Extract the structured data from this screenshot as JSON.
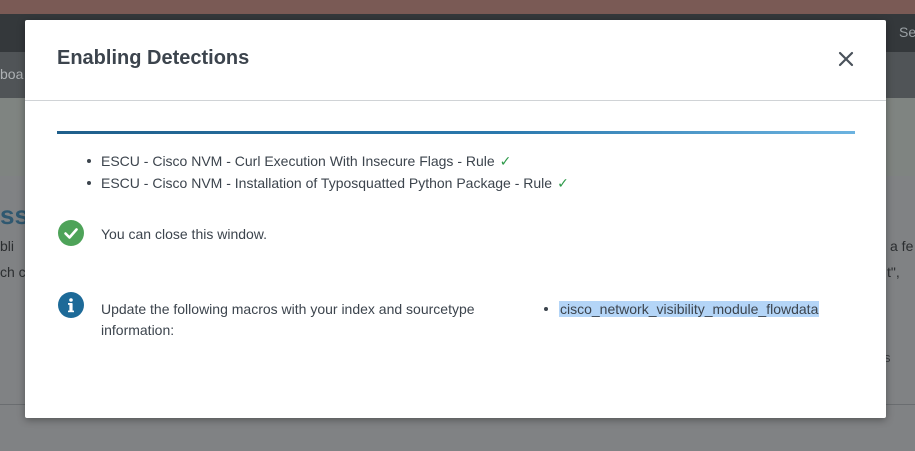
{
  "background": {
    "header_right_fragment": "Se",
    "subnav_left_fragment": "boa",
    "title_fragment": "ssi",
    "line1_fragment": "bli",
    "line2_fragment": "ch c",
    "right_fragment_1": "a fe",
    "right_fragment_2": "t\",",
    "right_fragment_3": "s"
  },
  "modal": {
    "title": "Enabling Detections",
    "close_icon": "close-icon",
    "progress": 1.0,
    "rules": [
      {
        "label": "ESCU - Cisco NVM - Curl Execution With Insecure Flags - Rule"
      },
      {
        "label": "ESCU - Cisco NVM - Installation of Typosquatted Python Package - Rule"
      }
    ],
    "check_symbol": "✓",
    "success_icon": "check-circle-icon",
    "success_message": "You can close this window.",
    "info_icon": "info-circle-icon",
    "info_message": "Update the following macros with your index and sourcetype information:",
    "macros": [
      {
        "name": "cisco_network_visibility_module_flowdata"
      }
    ]
  },
  "colors": {
    "success": "#4ea359",
    "info": "#1d6a98",
    "progress": "#2a78ad",
    "selection": "#b4d5f7"
  }
}
